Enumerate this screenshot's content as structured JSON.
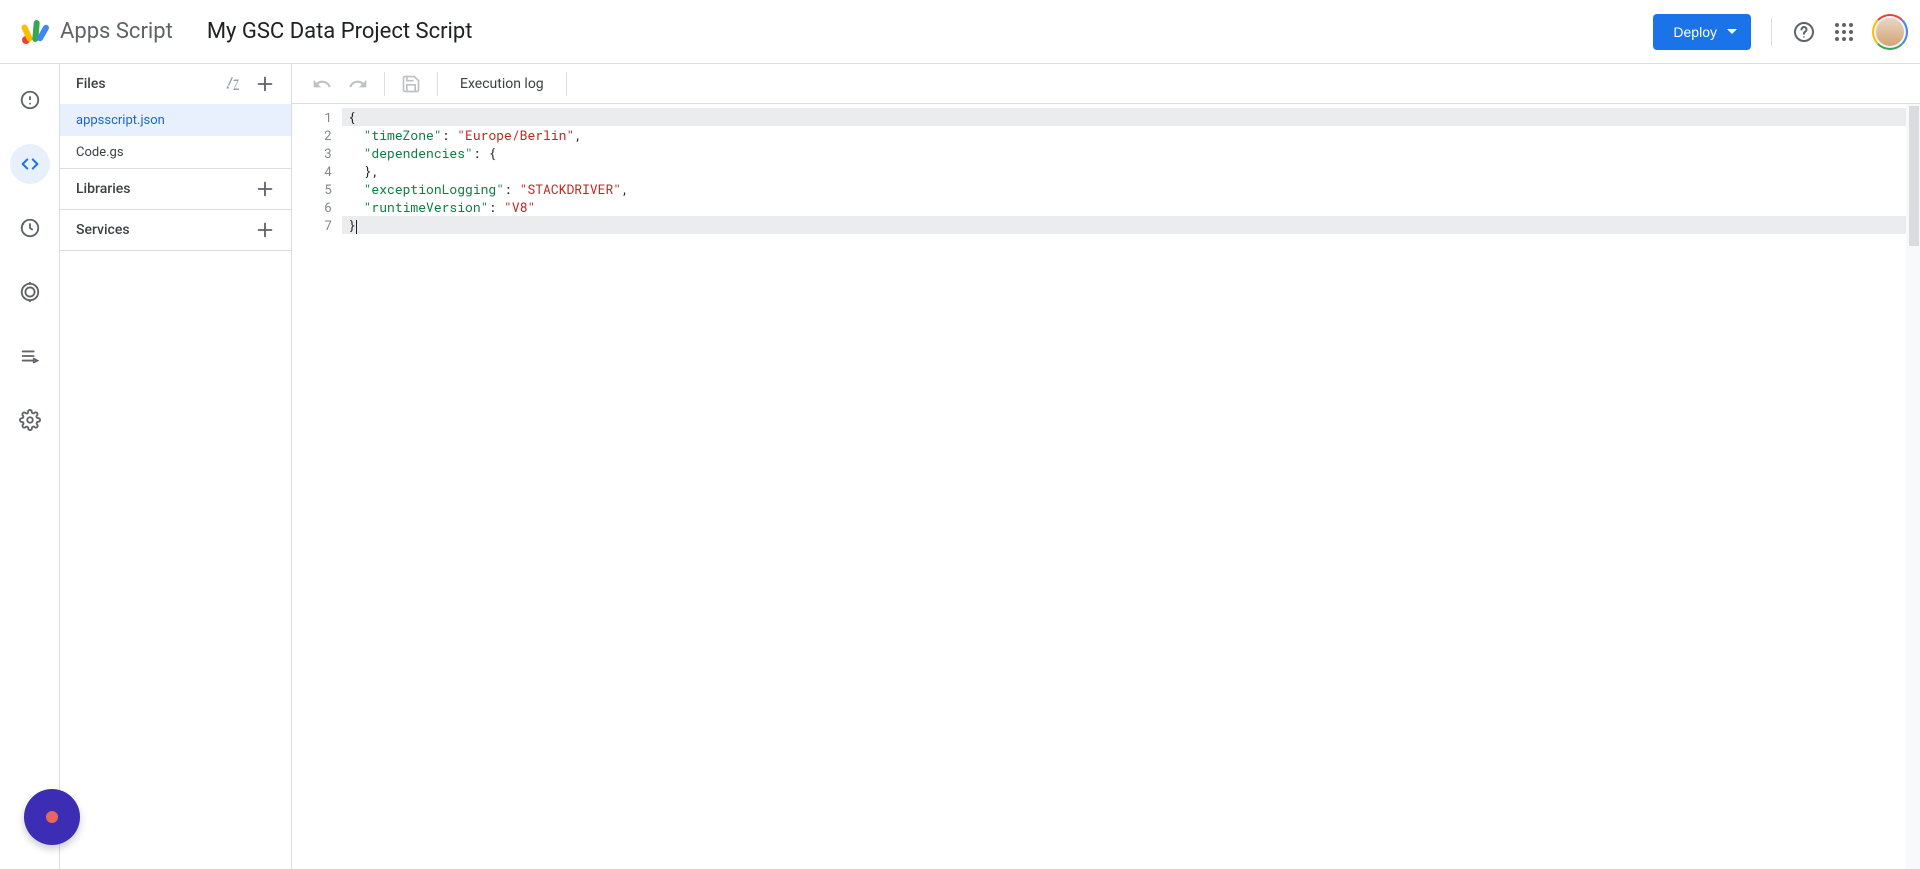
{
  "header": {
    "product_name": "Apps Script",
    "project_title": "My GSC Data Project Script",
    "deploy_label": "Deploy"
  },
  "nav_rail": {
    "items": [
      "overview",
      "editor",
      "triggers",
      "executions",
      "logs",
      "settings"
    ],
    "active": "editor"
  },
  "sidebar": {
    "files": {
      "title": "Files",
      "items": [
        {
          "name": "appsscript.json",
          "selected": true
        },
        {
          "name": "Code.gs",
          "selected": false
        }
      ]
    },
    "libraries": {
      "title": "Libraries"
    },
    "services": {
      "title": "Services"
    }
  },
  "toolbar": {
    "execution_log": "Execution log"
  },
  "editor": {
    "line_count": 7,
    "lines": {
      "l1": [
        "{"
      ],
      "l2_k": "\"timeZone\"",
      "l2_c": ": ",
      "l2_v": "\"Europe/Berlin\"",
      "l2_t": ",",
      "l3_k": "\"dependencies\"",
      "l3_c": ": ",
      "l3_v": "{",
      "l4": "  },",
      "l5_k": "\"exceptionLogging\"",
      "l5_c": ": ",
      "l5_v": "\"STACKDRIVER\"",
      "l5_t": ",",
      "l6_k": "\"runtimeVersion\"",
      "l6_c": ": ",
      "l6_v": "\"V8\"",
      "l7": "}"
    }
  }
}
